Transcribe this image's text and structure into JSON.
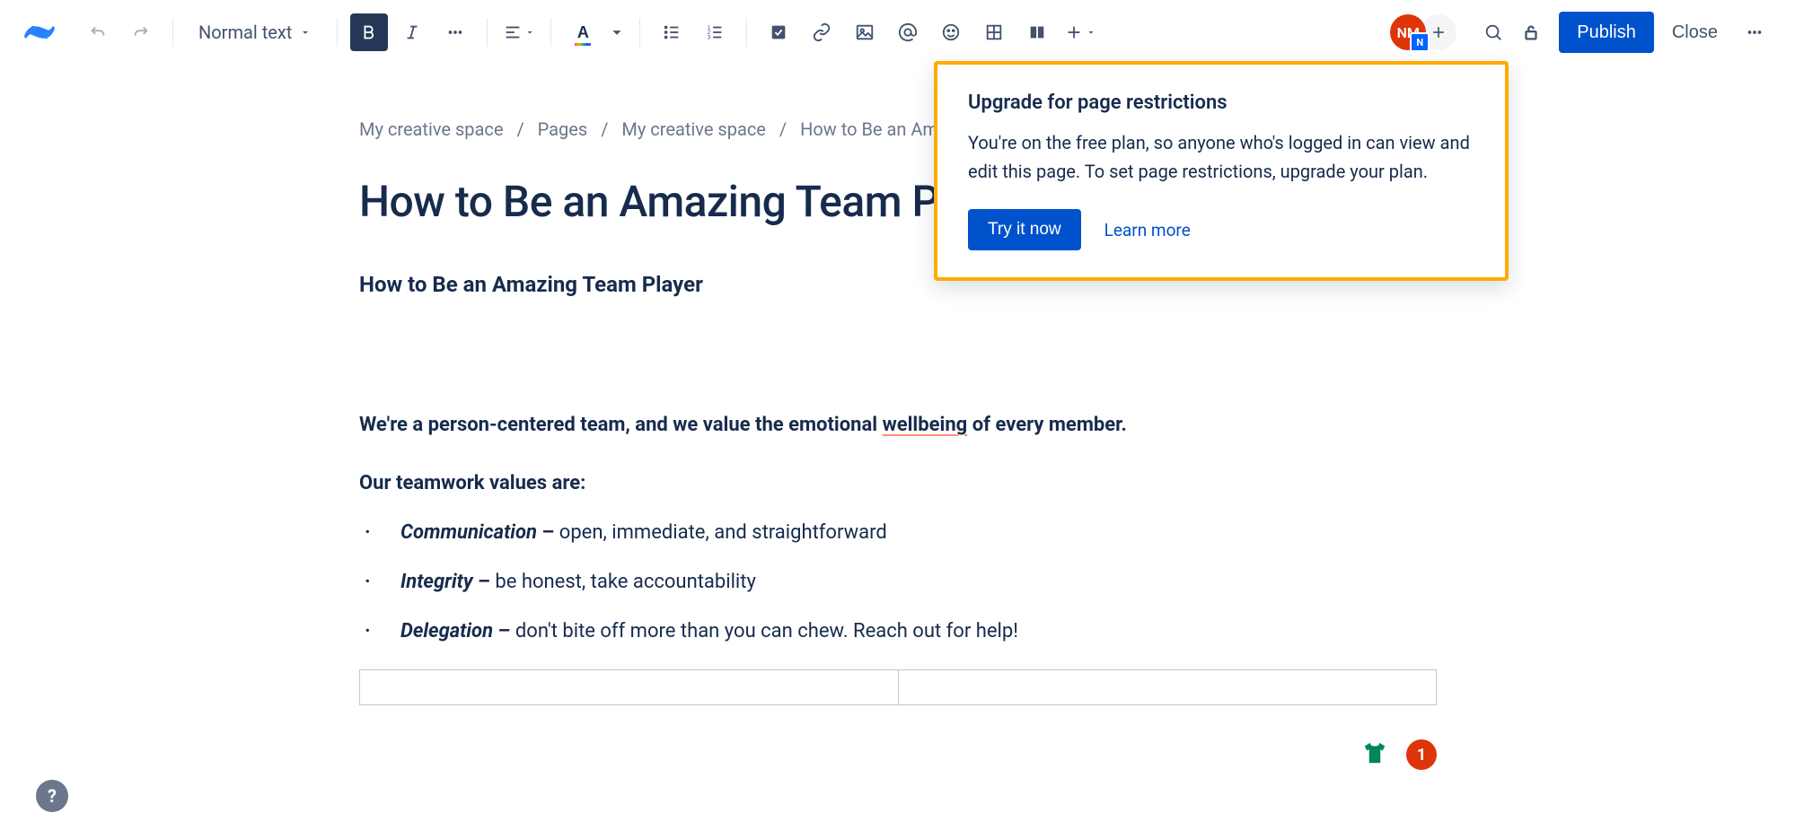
{
  "toolbar": {
    "text_style": "Normal text",
    "publish": "Publish",
    "close": "Close"
  },
  "avatar": {
    "initials": "NM",
    "badge": "N"
  },
  "breadcrumb": {
    "items": [
      "My creative space",
      "Pages",
      "My creative space",
      "How to Be an Amazing Team Player"
    ]
  },
  "page": {
    "title": "How to Be an Amazing Team Player",
    "heading": "How to Be an Amazing Team Player",
    "intro_prefix": "We're a person-centered team, and we value the emotional ",
    "intro_underlined": "wellbeing",
    "intro_suffix": " of every member.",
    "values_heading": "Our teamwork values are:",
    "values": [
      {
        "term": "Communication",
        "dash": " – ",
        "desc": "open, immediate, and straightforward"
      },
      {
        "term": "Integrity",
        "dash": " – ",
        "desc": "be honest, take accountability"
      },
      {
        "term": "Delegation",
        "dash": " – ",
        "desc": "don't bite off more than you can chew. Reach out for help!"
      }
    ]
  },
  "popover": {
    "title": "Upgrade for page restrictions",
    "body": "You're on the free plan, so anyone who's logged in can view and edit this page. To set page restrictions, upgrade your plan.",
    "primary": "Try it now",
    "secondary": "Learn more"
  },
  "float": {
    "badge": "1"
  },
  "help": "?"
}
